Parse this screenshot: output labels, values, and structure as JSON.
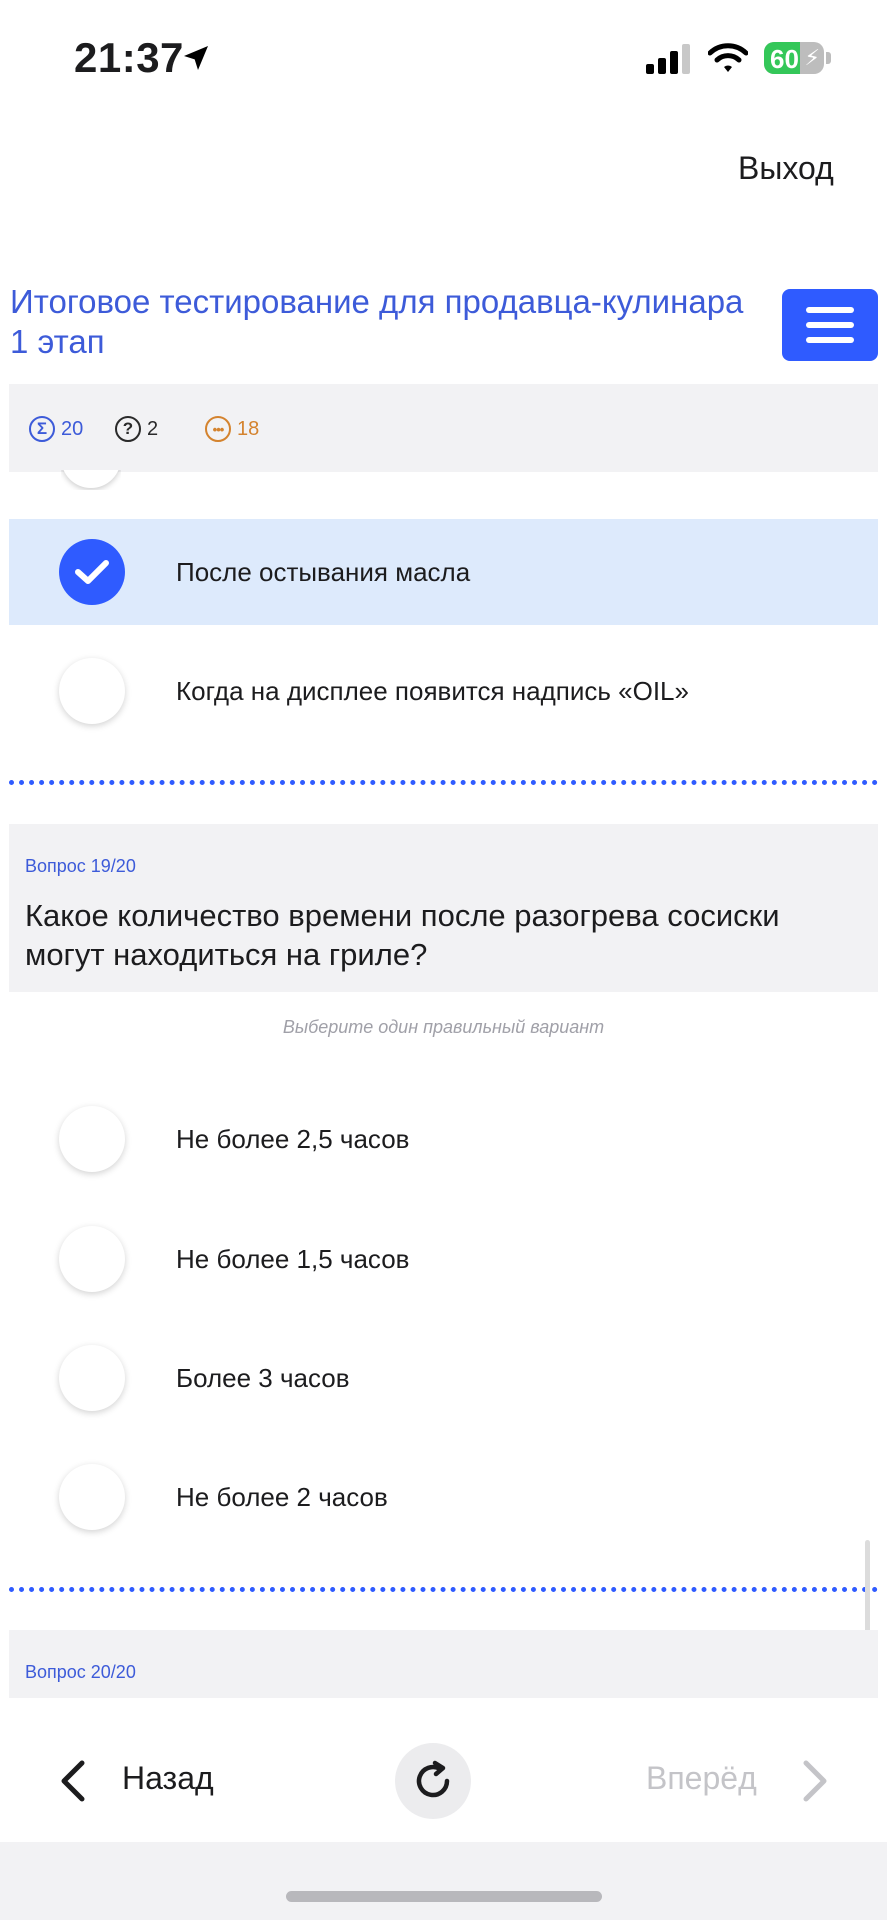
{
  "status_bar": {
    "time": "21:37",
    "battery_level": "60",
    "battery_percent": 60,
    "icons": [
      "location-arrow-icon",
      "cellular-signal-icon",
      "wifi-icon",
      "battery-charging-icon"
    ]
  },
  "header": {
    "exit_label": "Выход",
    "title": "Итоговое тестирование для продавца-кулинара 1 этап",
    "menu_icon": "hamburger-menu-icon"
  },
  "stats": {
    "total": "20",
    "answered": "2",
    "remaining": "18",
    "colors": {
      "total": "#3d5bd9",
      "answered": "#2a2a2a",
      "remaining": "#d4832e"
    }
  },
  "prev_question": {
    "options": [
      {
        "label": "После остывания масла",
        "selected": true
      },
      {
        "label": "Когда на дисплее появится надпись «OIL»",
        "selected": false
      }
    ]
  },
  "question_19": {
    "number": "Вопрос 19/20",
    "text": "Какое количество времени после разогрева сосиски могут находиться на гриле?",
    "hint": "Выберите один правильный вариант",
    "options": [
      {
        "label": "Не более 2,5 часов",
        "selected": false
      },
      {
        "label": "Не более 1,5 часов",
        "selected": false
      },
      {
        "label": "Более 3 часов",
        "selected": false
      },
      {
        "label": "Не более 2 часов",
        "selected": false
      }
    ]
  },
  "question_20": {
    "number": "Вопрос 20/20"
  },
  "nav": {
    "back_label": "Назад",
    "forward_label": "Вперёд",
    "reload_icon": "reload-icon"
  },
  "colors": {
    "accent": "#2f5bff",
    "title": "#3d5bd9",
    "selected_bg": "#ddeafc",
    "card_bg": "#f2f2f4"
  }
}
